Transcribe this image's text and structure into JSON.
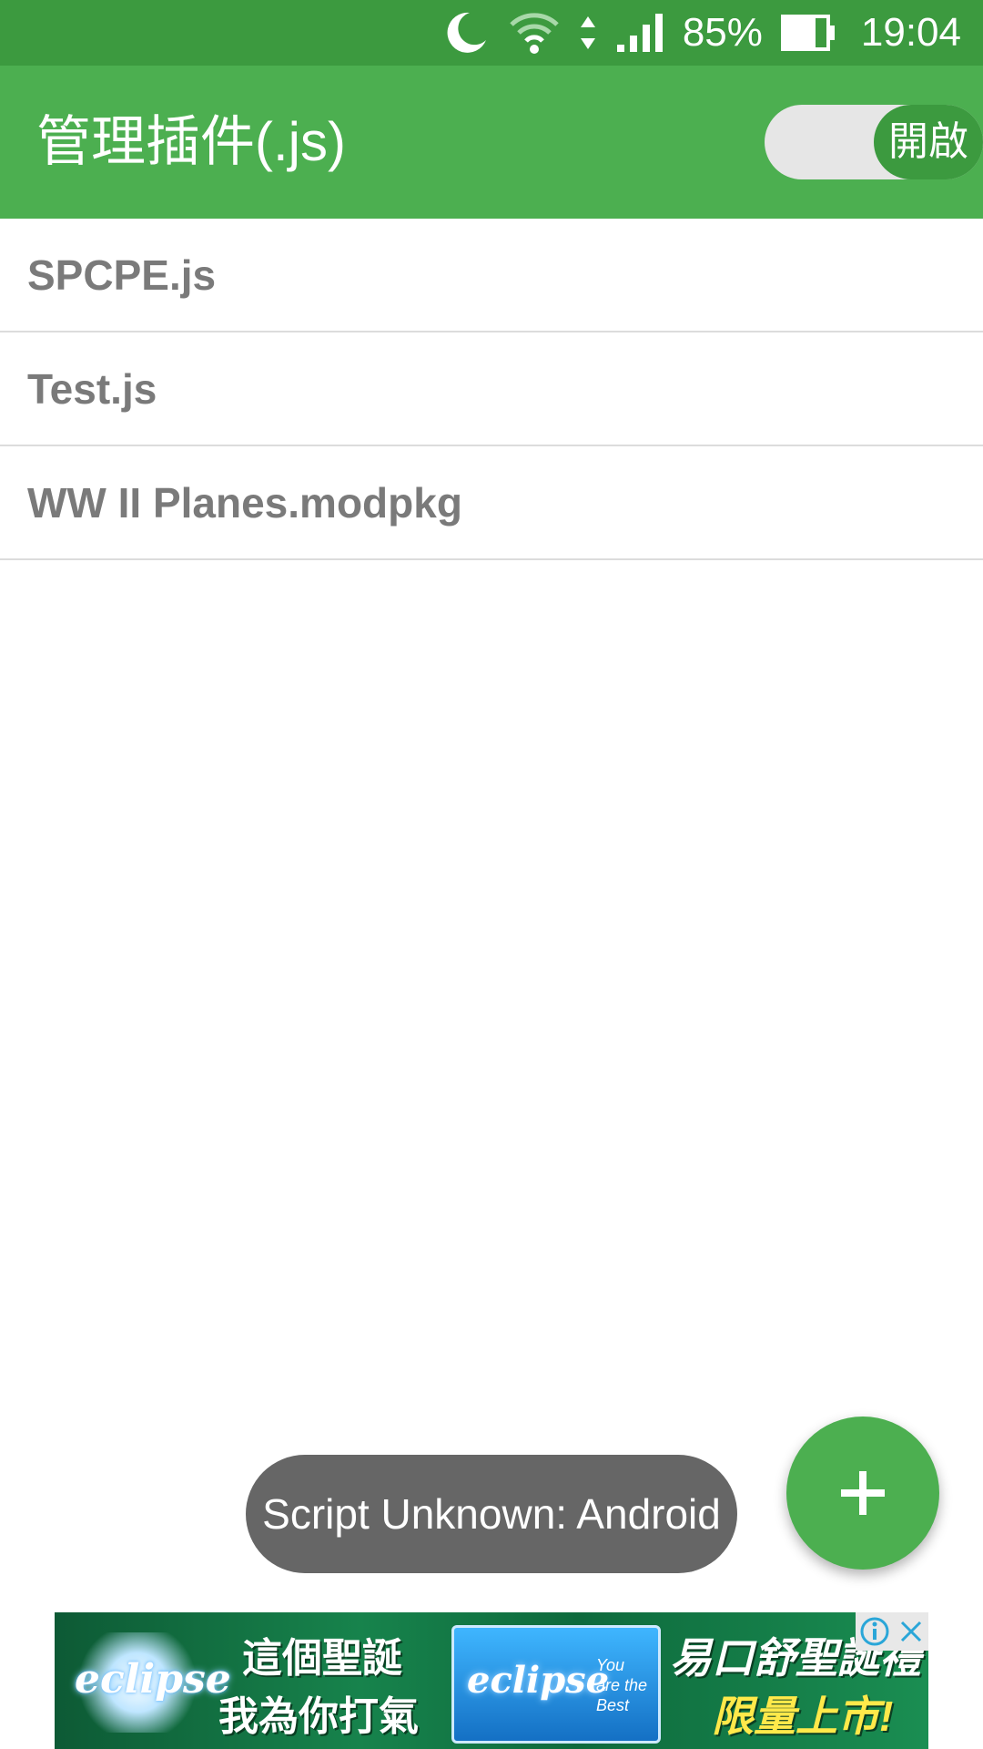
{
  "status_bar": {
    "battery_percent": "85%",
    "time": "19:04",
    "icons": [
      "moon-icon",
      "wifi-icon",
      "data-arrows-icon",
      "signal-icon",
      "battery-icon"
    ]
  },
  "app_bar": {
    "title": "管理插件(.js)",
    "toggle_label": "開啟",
    "toggle_on": true
  },
  "scripts": [
    {
      "label": "SPCPE.js"
    },
    {
      "label": "Test.js"
    },
    {
      "label": "WW II Planes.modpkg"
    }
  ],
  "toast": {
    "text": "Script Unknown: Android"
  },
  "fab": {
    "icon": "plus-icon"
  },
  "ad": {
    "brand": "eclipse",
    "headline_line1": "這個聖誕",
    "headline_line2": "我為你打氣",
    "pack_tagline": "You are the Best",
    "slogan_line1": "易口舒聖誕禮",
    "slogan_line2": "限量上市!",
    "icons": [
      "ad-info-icon",
      "ad-close-icon"
    ]
  },
  "colors": {
    "primary": "#4caf50",
    "primary_dark": "#3c9a3f",
    "list_text": "#7a7a7a",
    "toast_bg": "#666666"
  }
}
